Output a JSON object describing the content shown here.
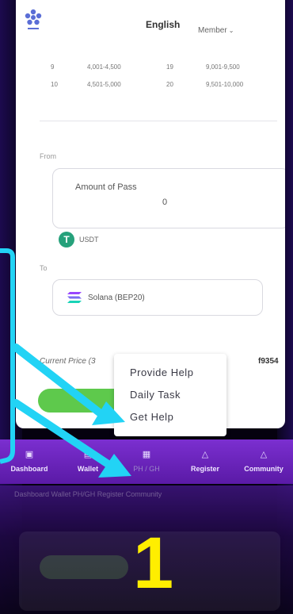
{
  "header": {
    "language": "English",
    "member": "Member",
    "logo_icon": "star-logo-icon"
  },
  "table": {
    "rows": [
      {
        "c1": "9",
        "c2": "4,001-4,500",
        "c3": "19",
        "c4": "9,001-9,500"
      },
      {
        "c1": "10",
        "c2": "4,501-5,000",
        "c3": "20",
        "c4": "9,501-10,000"
      }
    ]
  },
  "form": {
    "from_label": "From",
    "pass_label": "Amount of Pass",
    "pass_value": "0",
    "usdt_label": "USDT",
    "to_label": "To",
    "network_label": "Solana (BEP20)",
    "price_label": "Current Price (3",
    "price_value": "f9354"
  },
  "popup": {
    "items": [
      "Provide Help",
      "Daily Task",
      "Get Help"
    ]
  },
  "nav": {
    "items": [
      {
        "label": "Dashboard",
        "icon": "dashboard-icon"
      },
      {
        "label": "Wallet",
        "icon": "wallet-icon"
      },
      {
        "label": "PH / GH",
        "icon": "ph-gh-icon"
      },
      {
        "label": "Register",
        "icon": "register-icon"
      },
      {
        "label": "Community",
        "icon": "community-icon"
      }
    ]
  },
  "reflection": {
    "labels": "Dashboard  Wallet  PH/GH  Register  Community"
  },
  "annotation": {
    "step": "1",
    "frame_color": "#22d3f5",
    "arrow_color": "#22d3f5",
    "step_color": "#ffee00"
  },
  "colors": {
    "nav_bg": "#6a22c0",
    "buy_button": "#5ec94c",
    "usdt": "#26a17b"
  }
}
